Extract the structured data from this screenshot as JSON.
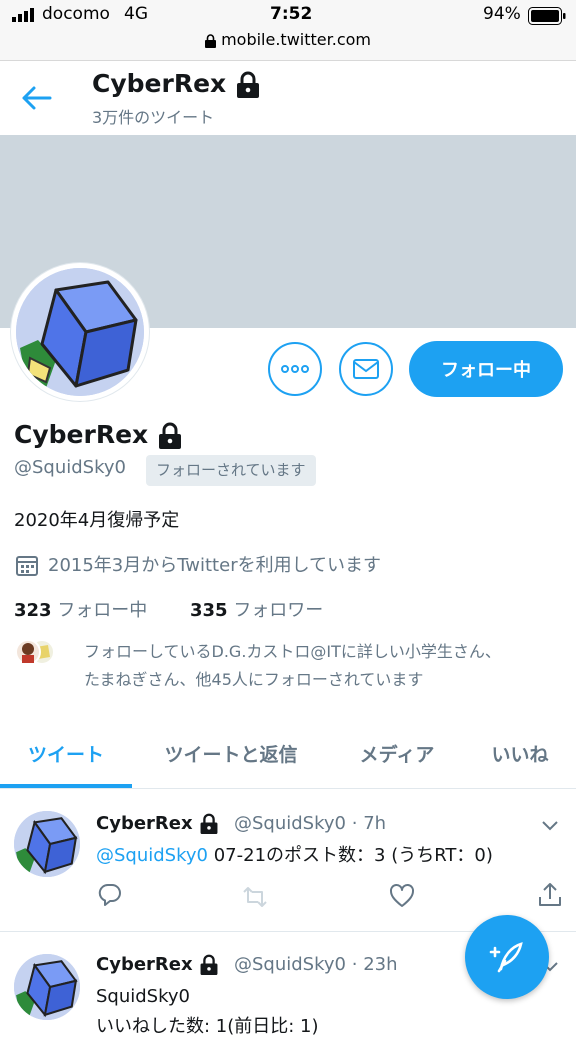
{
  "status_bar": {
    "carrier": "docomo",
    "network": "4G",
    "time": "7:52",
    "battery": "94%",
    "url": "mobile.twitter.com"
  },
  "header": {
    "name": "CyberRex",
    "tweet_count": "3万件のツイート"
  },
  "profile": {
    "name": "CyberRex",
    "handle": "@SquidSky0",
    "follows_you": "フォローされています",
    "bio": "2020年4月復帰予定",
    "joined": "2015年3月からTwitterを利用しています",
    "following_count": "323",
    "following_label": "フォロー中",
    "followers_count": "335",
    "followers_label": "フォロワー",
    "followed_by_line1": "フォローしているD.G.カストロ@ITに詳しい小学生さん、",
    "followed_by_line2": "たまねぎさん、他45人にフォローされています",
    "follow_button": "フォロー中"
  },
  "tabs": [
    {
      "label": "ツイート",
      "active": true
    },
    {
      "label": "ツイートと返信",
      "active": false
    },
    {
      "label": "メディア",
      "active": false
    },
    {
      "label": "いいね",
      "active": false
    }
  ],
  "tweets": [
    {
      "name": "CyberRex",
      "handle": "@SquidSky0",
      "sep": "·",
      "time": "7h",
      "mention": "@SquidSky0",
      "text": " 07-21のポスト数：3 (うちRT：0)"
    },
    {
      "name": "CyberRex",
      "handle": "@SquidSky0",
      "sep": "·",
      "time": "23h",
      "line1": "SquidSky0",
      "line2": "いいねした数: 1(前日比: 1)"
    }
  ],
  "colors": {
    "accent": "#1da1f2",
    "banner": "#ccd6dd",
    "secondary_text": "#657786"
  }
}
